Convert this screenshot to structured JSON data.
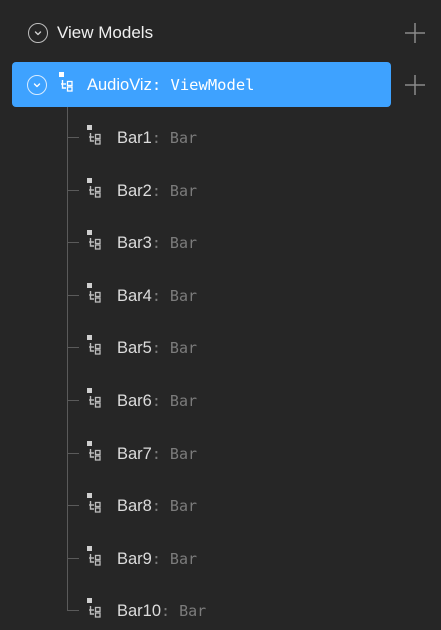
{
  "header": {
    "title": "View Models",
    "icon": "chevron-down-icon",
    "add_icon": "plus-icon"
  },
  "selected": {
    "name": "AudioViz",
    "type": ": ViewModel",
    "icon": "viewmodel-icon",
    "accent": "#3ea2ff"
  },
  "children": [
    {
      "name": "Bar1",
      "type": ": Bar"
    },
    {
      "name": "Bar2",
      "type": ": Bar"
    },
    {
      "name": "Bar3",
      "type": ": Bar"
    },
    {
      "name": "Bar4",
      "type": ": Bar"
    },
    {
      "name": "Bar5",
      "type": ": Bar"
    },
    {
      "name": "Bar6",
      "type": ": Bar"
    },
    {
      "name": "Bar7",
      "type": ": Bar"
    },
    {
      "name": "Bar8",
      "type": ": Bar"
    },
    {
      "name": "Bar9",
      "type": ": Bar"
    },
    {
      "name": "Bar10",
      "type": ": Bar"
    }
  ]
}
